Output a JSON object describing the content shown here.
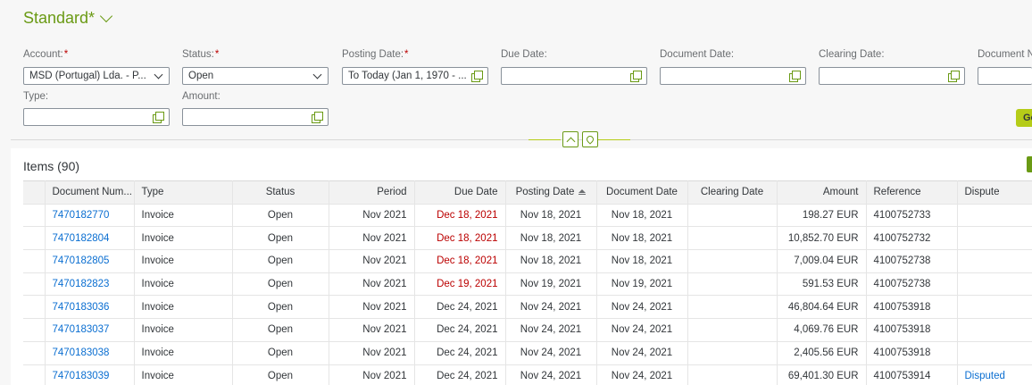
{
  "variant": {
    "name": "Standard*"
  },
  "filters": {
    "account": {
      "label": "Account:",
      "value": "MSD (Portugal) Lda. - P..."
    },
    "status": {
      "label": "Status:",
      "value": "Open"
    },
    "posting_date": {
      "label": "Posting Date:",
      "value": "To Today (Jan 1, 1970 - ..."
    },
    "due_date": {
      "label": "Due Date:",
      "value": ""
    },
    "document_date": {
      "label": "Document Date:",
      "value": ""
    },
    "clearing_date": {
      "label": "Clearing Date:",
      "value": ""
    },
    "document_number": {
      "label": "Document Nu",
      "value": ""
    },
    "type": {
      "label": "Type:",
      "value": ""
    },
    "amount": {
      "label": "Amount:",
      "value": ""
    },
    "required_mark": "*"
  },
  "go_label": "Go",
  "items": {
    "title": "Items (90)",
    "columns": [
      "Document Num...",
      "Type",
      "Status",
      "Period",
      "Due Date",
      "Posting Date",
      "Document Date",
      "Clearing Date",
      "Amount",
      "Reference",
      "Dispute"
    ],
    "rows": [
      [
        "7470182770",
        "Invoice",
        "Open",
        "Nov 2021",
        "Dec 18, 2021",
        "Nov 18, 2021",
        "Nov 18, 2021",
        "",
        "198.27 EUR",
        "4100752733",
        ""
      ],
      [
        "7470182804",
        "Invoice",
        "Open",
        "Nov 2021",
        "Dec 18, 2021",
        "Nov 18, 2021",
        "Nov 18, 2021",
        "",
        "10,852.70 EUR",
        "4100752732",
        ""
      ],
      [
        "7470182805",
        "Invoice",
        "Open",
        "Nov 2021",
        "Dec 18, 2021",
        "Nov 18, 2021",
        "Nov 18, 2021",
        "",
        "7,009.04 EUR",
        "4100752738",
        ""
      ],
      [
        "7470182823",
        "Invoice",
        "Open",
        "Nov 2021",
        "Dec 19, 2021",
        "Nov 19, 2021",
        "Nov 19, 2021",
        "",
        "591.53 EUR",
        "4100752738",
        ""
      ],
      [
        "7470183036",
        "Invoice",
        "Open",
        "Nov 2021",
        "Dec 24, 2021",
        "Nov 24, 2021",
        "Nov 24, 2021",
        "",
        "46,804.64 EUR",
        "4100753918",
        ""
      ],
      [
        "7470183037",
        "Invoice",
        "Open",
        "Nov 2021",
        "Dec 24, 2021",
        "Nov 24, 2021",
        "Nov 24, 2021",
        "",
        "4,069.76 EUR",
        "4100753918",
        ""
      ],
      [
        "7470183038",
        "Invoice",
        "Open",
        "Nov 2021",
        "Dec 24, 2021",
        "Nov 24, 2021",
        "Nov 24, 2021",
        "",
        "2,405.56 EUR",
        "4100753918",
        ""
      ],
      [
        "7470183039",
        "Invoice",
        "Open",
        "Nov 2021",
        "Dec 24, 2021",
        "Nov 24, 2021",
        "Nov 24, 2021",
        "",
        "69,401.30 EUR",
        "4100753914",
        "Disputed"
      ]
    ],
    "overdue_rows": [
      0,
      1,
      2,
      3
    ]
  },
  "colors": {
    "accent": "#6a9a14",
    "link": "#0a6ed1",
    "overdue": "#bb0000",
    "go_button": "#b5cc18"
  }
}
